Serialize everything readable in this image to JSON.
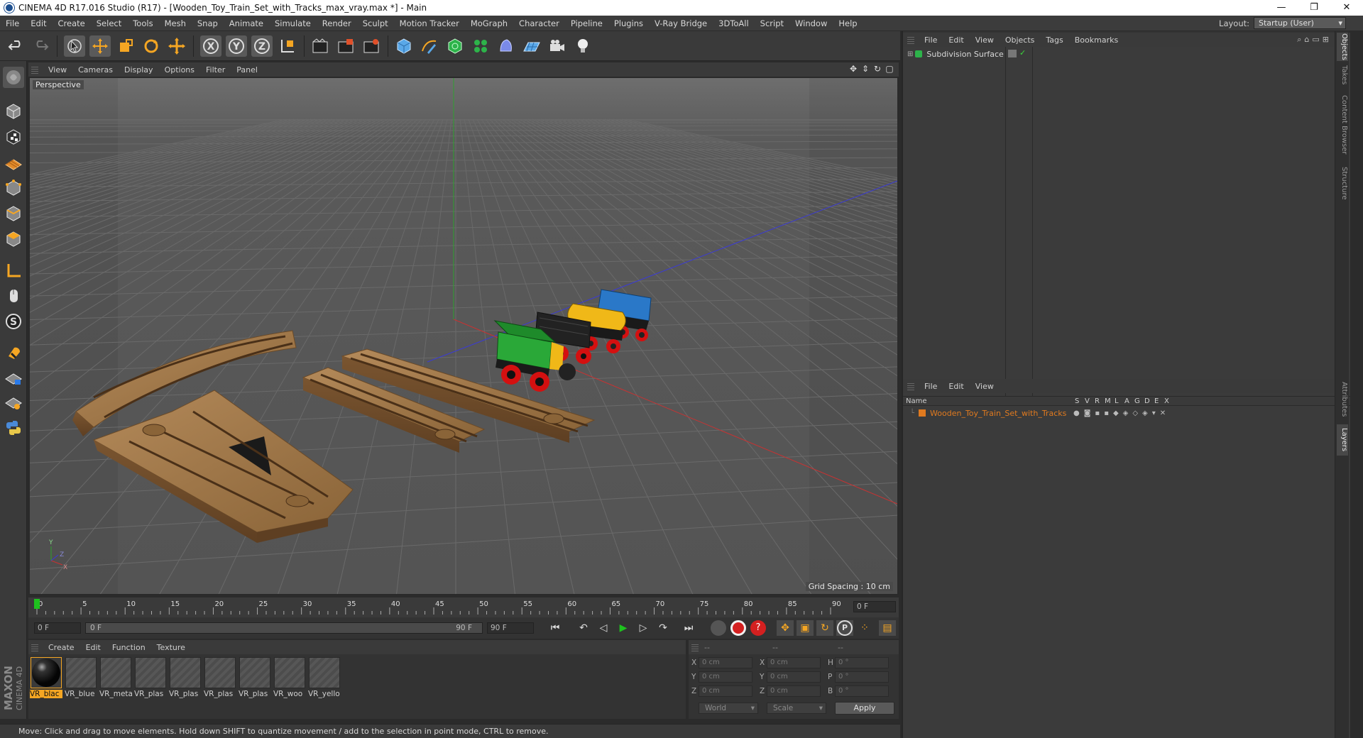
{
  "window": {
    "title": "CINEMA 4D R17.016 Studio (R17) - [Wooden_Toy_Train_Set_with_Tracks_max_vray.max *] - Main",
    "minimize": "—",
    "restore": "❐",
    "close": "✕"
  },
  "menu": {
    "items": [
      "File",
      "Edit",
      "Create",
      "Select",
      "Tools",
      "Mesh",
      "Snap",
      "Animate",
      "Simulate",
      "Render",
      "Sculpt",
      "Motion Tracker",
      "MoGraph",
      "Character",
      "Pipeline",
      "Plugins",
      "V-Ray Bridge",
      "3DToAll",
      "Script",
      "Window",
      "Help"
    ],
    "layout_label": "Layout:",
    "layout_value": "Startup (User)"
  },
  "viewport": {
    "menu": [
      "View",
      "Cameras",
      "Display",
      "Options",
      "Filter",
      "Panel"
    ],
    "label": "Perspective",
    "grid_spacing": "Grid Spacing : 10 cm",
    "axis_labels": {
      "y": "Y",
      "x": "X",
      "z": "Z"
    }
  },
  "timeline": {
    "ticks": [
      "0",
      "5",
      "10",
      "15",
      "20",
      "25",
      "30",
      "35",
      "40",
      "45",
      "50",
      "55",
      "60",
      "65",
      "70",
      "75",
      "80",
      "85",
      "90"
    ],
    "current_frame": "0 F",
    "start_field": "0 F",
    "range_start": "0 F",
    "range_end": "90 F",
    "end_field": "90 F"
  },
  "materials": {
    "menu": [
      "Create",
      "Edit",
      "Function",
      "Texture"
    ],
    "items": [
      "VR_blac",
      "VR_blue",
      "VR_meta",
      "VR_plas",
      "VR_plas",
      "VR_plas",
      "VR_plas",
      "VR_woo",
      "VR_yello"
    ]
  },
  "coordinates": {
    "headers": [
      "--",
      "--",
      "--"
    ],
    "row_labels": [
      [
        "X",
        "X",
        "H"
      ],
      [
        "Y",
        "Y",
        "P"
      ],
      [
        "Z",
        "Z",
        "B"
      ]
    ],
    "values": [
      [
        "0 cm",
        "0 cm",
        "0 °"
      ],
      [
        "0 cm",
        "0 cm",
        "0 °"
      ],
      [
        "0 cm",
        "0 cm",
        "0 °"
      ]
    ],
    "mode": "World",
    "scale": "Scale",
    "apply": "Apply"
  },
  "objects_panel": {
    "menu": [
      "File",
      "Edit",
      "View",
      "Objects",
      "Tags",
      "Bookmarks"
    ],
    "object_name": "Subdivision Surface"
  },
  "layers_panel": {
    "menu": [
      "File",
      "Edit",
      "View"
    ],
    "name_header": "Name",
    "columns": [
      "S",
      "V",
      "R",
      "M",
      "L",
      "A",
      "G",
      "D",
      "E",
      "X"
    ],
    "layer_name": "Wooden_Toy_Train_Set_with_Tracks",
    "layer_color": "#e07a1f"
  },
  "side_tabs": [
    "Objects",
    "Takes",
    "Content Browser",
    "Structure",
    "Attributes",
    "Layers"
  ],
  "status": "Move: Click and drag to move elements. Hold down SHIFT to quantize movement / add to the selection in point mode, CTRL to remove.",
  "branding": {
    "maxon": "MAXON",
    "cinema": "CINEMA 4D"
  }
}
